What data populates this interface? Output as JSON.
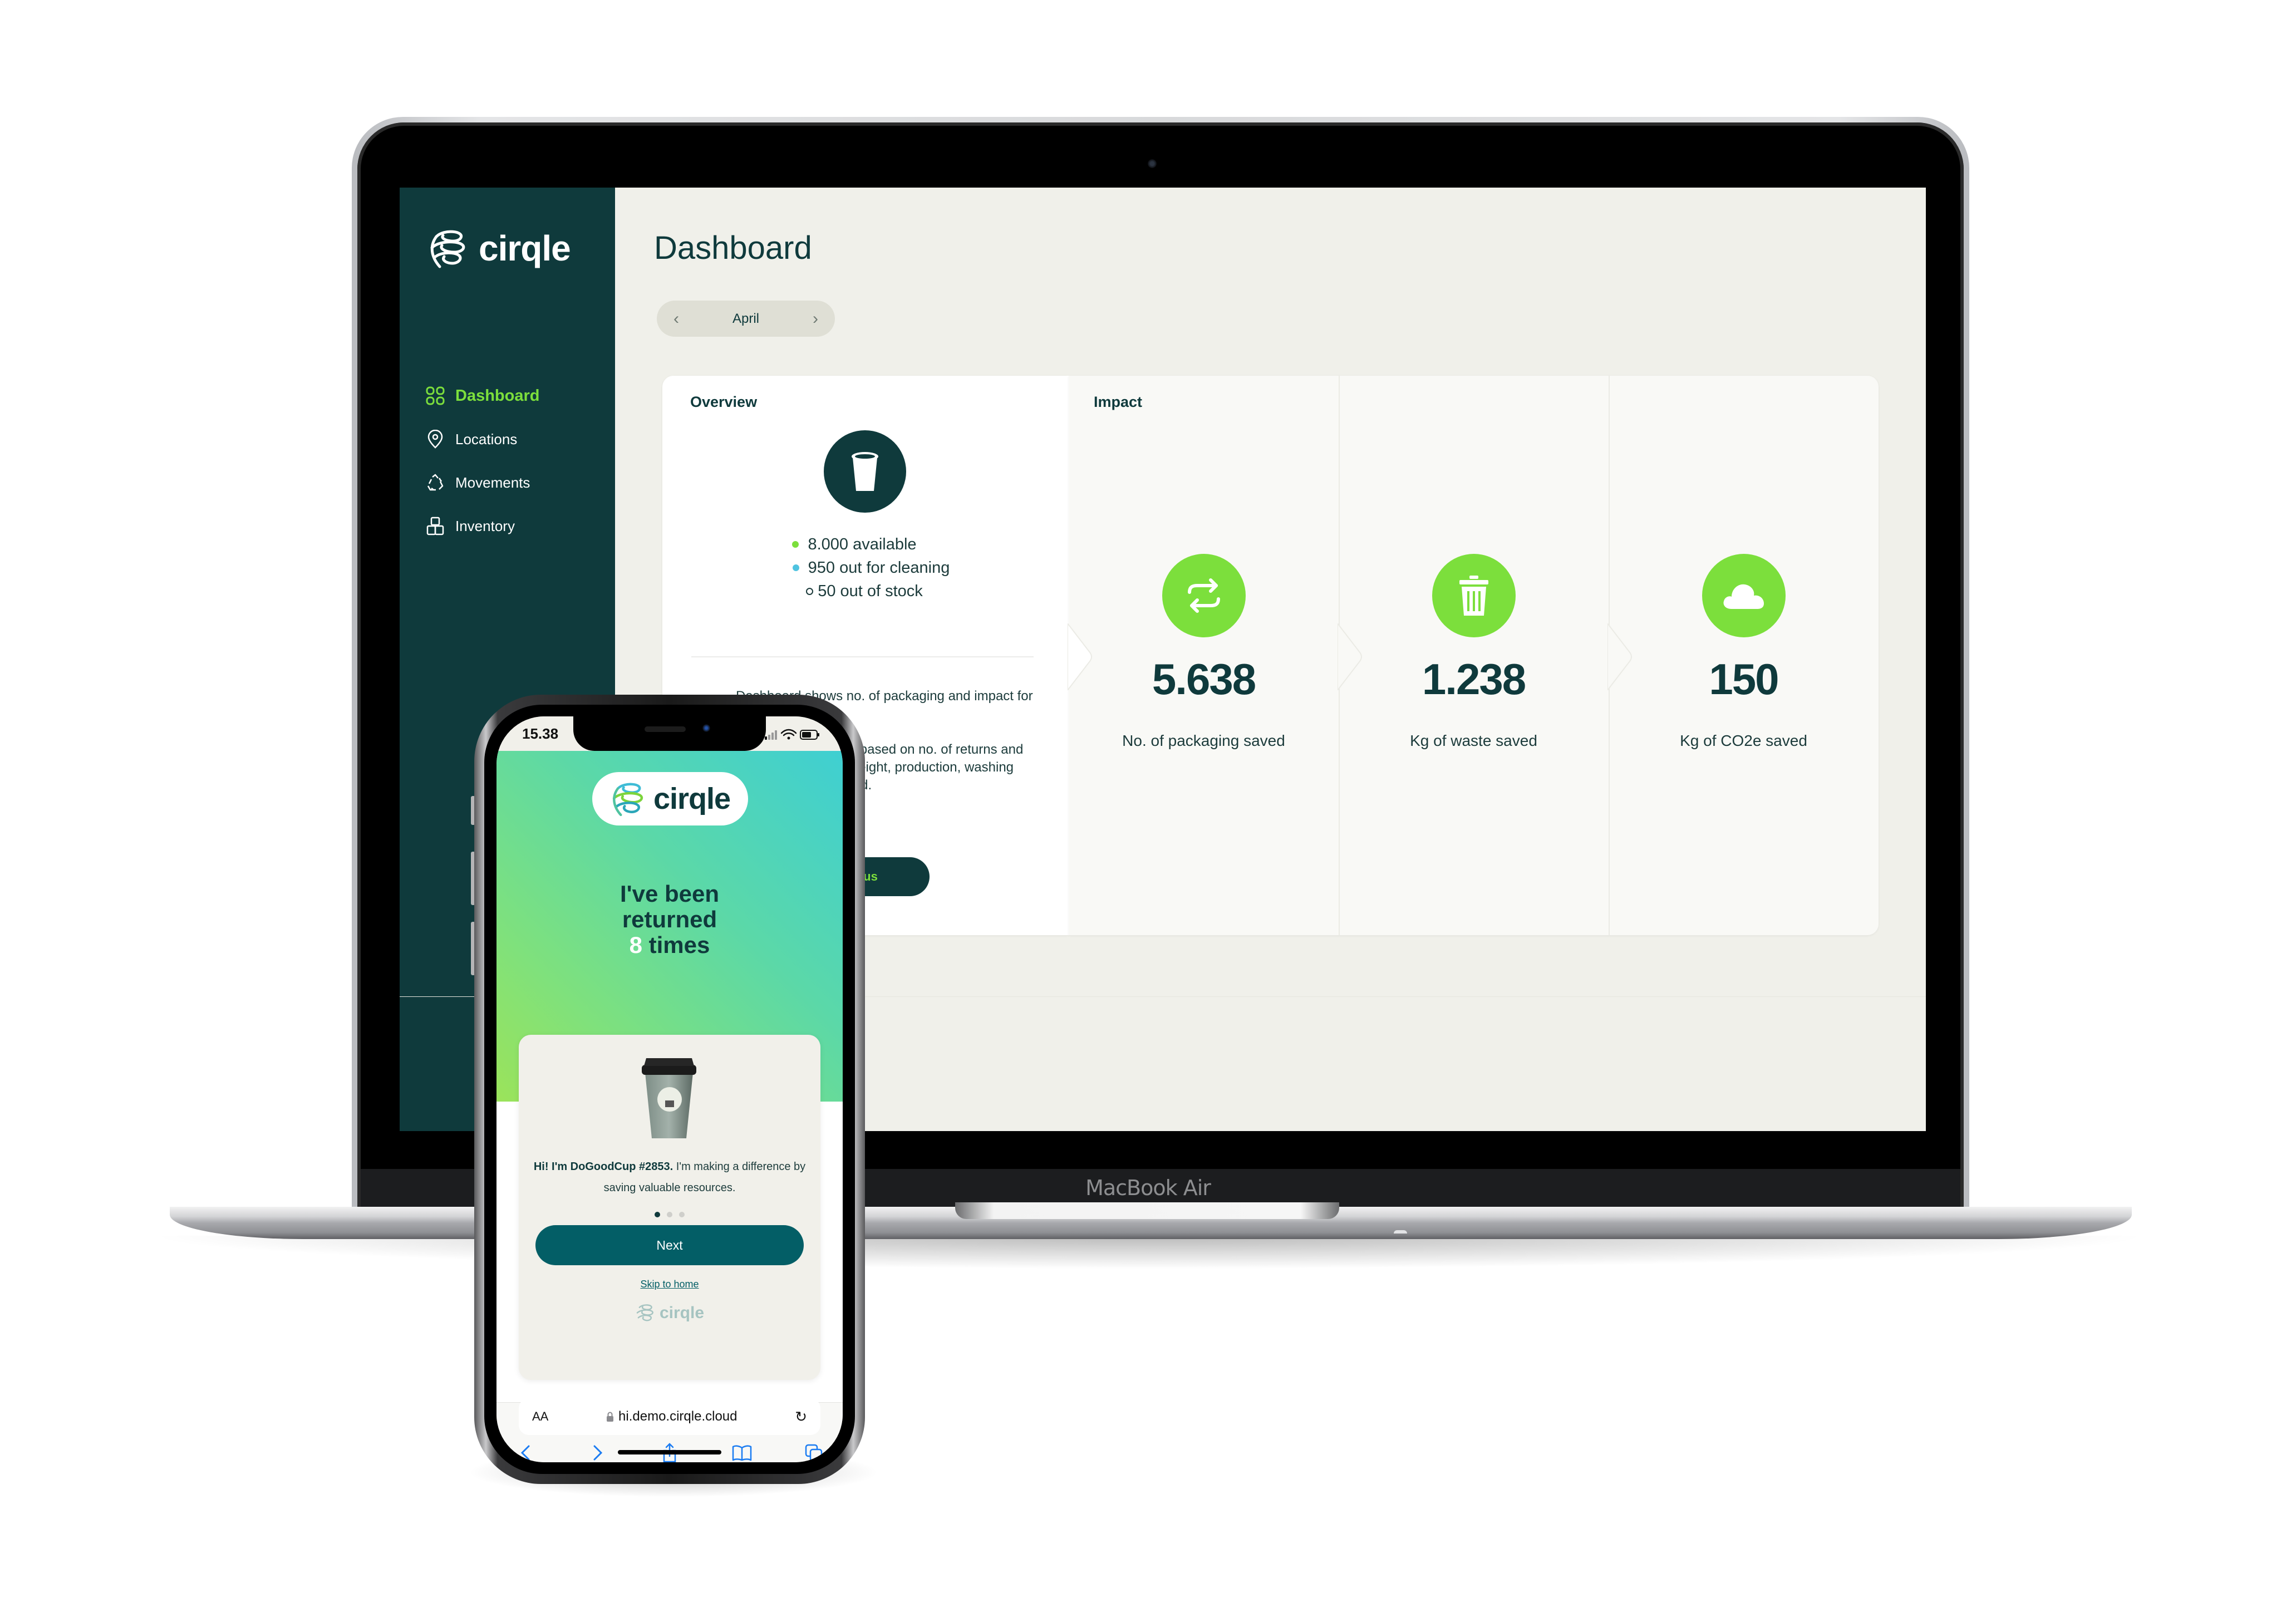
{
  "laptop": {
    "model_label": "MacBook Air"
  },
  "dashboard": {
    "brand": "cirqle",
    "sidebar": {
      "items": [
        {
          "label": "Dashboard",
          "icon": "grid-icon",
          "active": true
        },
        {
          "label": "Locations",
          "icon": "map-pin-icon",
          "active": false
        },
        {
          "label": "Movements",
          "icon": "recycle-icon",
          "active": false
        },
        {
          "label": "Inventory",
          "icon": "boxes-icon",
          "active": false
        }
      ]
    },
    "page_title": "Dashboard",
    "period": {
      "prev_icon": "chevron-left-icon",
      "label": "April",
      "next_icon": "chevron-right-icon"
    },
    "overview": {
      "title": "Overview",
      "icon": "cup-icon",
      "stock": [
        {
          "text": "8.000 available",
          "color": "#7cdf3c",
          "style": "filled"
        },
        {
          "text": "950 out for cleaning",
          "color": "#4fc3e0",
          "style": "filled"
        },
        {
          "text": "50 out of stock",
          "color": "#1c3b3b",
          "style": "outline"
        }
      ],
      "description": [
        "Dashboard shows no. of packaging and impact for selected period.",
        "Impact calculation is based on no. of returns and data on packaging weight, production, washing and transport included."
      ],
      "contact_button": "Contact us"
    },
    "impact": {
      "title": "Impact",
      "accent": "#7cdf3c",
      "metrics": [
        {
          "icon": "swap-arrows-icon",
          "value": "5.638",
          "label": "No. of packaging saved"
        },
        {
          "icon": "trash-icon",
          "value": "1.238",
          "label": "Kg of waste saved"
        },
        {
          "icon": "cloud-icon",
          "value": "150",
          "label": "Kg of CO2e saved"
        }
      ]
    }
  },
  "phone": {
    "status": {
      "time": "15.38"
    },
    "brand": "cirqle",
    "hero": {
      "line1": "I've been",
      "line2": "returned",
      "count": "8",
      "line3_suffix": " times"
    },
    "card": {
      "greeting_bold": "Hi! I'm DoGoodCup #2853.",
      "greeting_rest": " I'm making a difference by saving valuable resources.",
      "carousel": {
        "total": 3,
        "active": 1
      },
      "next_button": "Next",
      "skip_link": "Skip to home",
      "footer_brand": "cirqle"
    },
    "browser": {
      "text_size_label": "AA",
      "url": "hi.demo.cirqle.cloud",
      "toolbar": [
        "back-icon",
        "forward-icon",
        "share-icon",
        "bookmarks-icon",
        "tabs-icon"
      ]
    }
  }
}
